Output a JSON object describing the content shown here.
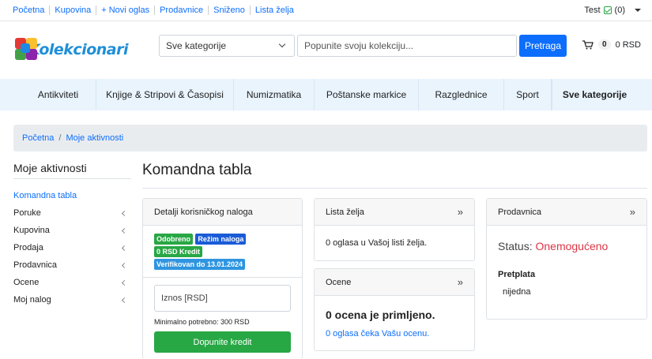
{
  "topbar": {
    "links": [
      "Početna",
      "Kupovina",
      "+ Novi oglas",
      "Prodavnice",
      "Sniženo",
      "Lista želja"
    ],
    "user": "Test",
    "wishlist_count": "(0)"
  },
  "header": {
    "logo_text": "Kolekcionari",
    "category_select": "Sve kategorije",
    "search_placeholder": "Popunite svoju kolekciju...",
    "search_button": "Pretraga",
    "cart_count": "0",
    "cart_total": "0 RSD"
  },
  "catnav": [
    "Antikviteti",
    "Knjige & Stripovi & Časopisi",
    "Numizmatika",
    "Poštanske markice",
    "Razglednice",
    "Sport",
    "Sve kategorije"
  ],
  "breadcrumb": [
    "Početna",
    "Moje aktivnosti"
  ],
  "sidebar": {
    "title": "Moje aktivnosti",
    "items": [
      "Komandna tabla",
      "Poruke",
      "Kupovina",
      "Prodaja",
      "Prodavnica",
      "Ocene",
      "Moj nalog"
    ]
  },
  "main": {
    "title": "Komandna tabla",
    "account": {
      "header": "Detalji korisničkog naloga",
      "badge_approved": "Odobreno",
      "badge_mode": "Režim naloga",
      "badge_credit": "0 RSD Kredit",
      "badge_verified": "Verifikovan do 13.01.2024",
      "amount_placeholder": "Iznos [RSD]",
      "min_text": "Minimalno potrebno: 300 RSD",
      "topup_button": "Dopunite kredit"
    },
    "wishlist": {
      "header": "Lista želja",
      "text": "0 oglasa u Vašoj listi želja."
    },
    "ratings": {
      "header": "Ocene",
      "count_text": "0 ocena je primljeno.",
      "pending_text": "0 oglasa čeka Vašu ocenu."
    },
    "shop": {
      "header": "Prodavnica",
      "status_label": "Status:",
      "status_value": "Onemogućeno",
      "subscription_label": "Pretplata",
      "subscription_value": "nijedna"
    },
    "arrows": "»"
  },
  "colors": {
    "primary": "#0d6efd",
    "success": "#28a745",
    "danger": "#dc3545",
    "nav_bg": "#e9f4fd"
  }
}
